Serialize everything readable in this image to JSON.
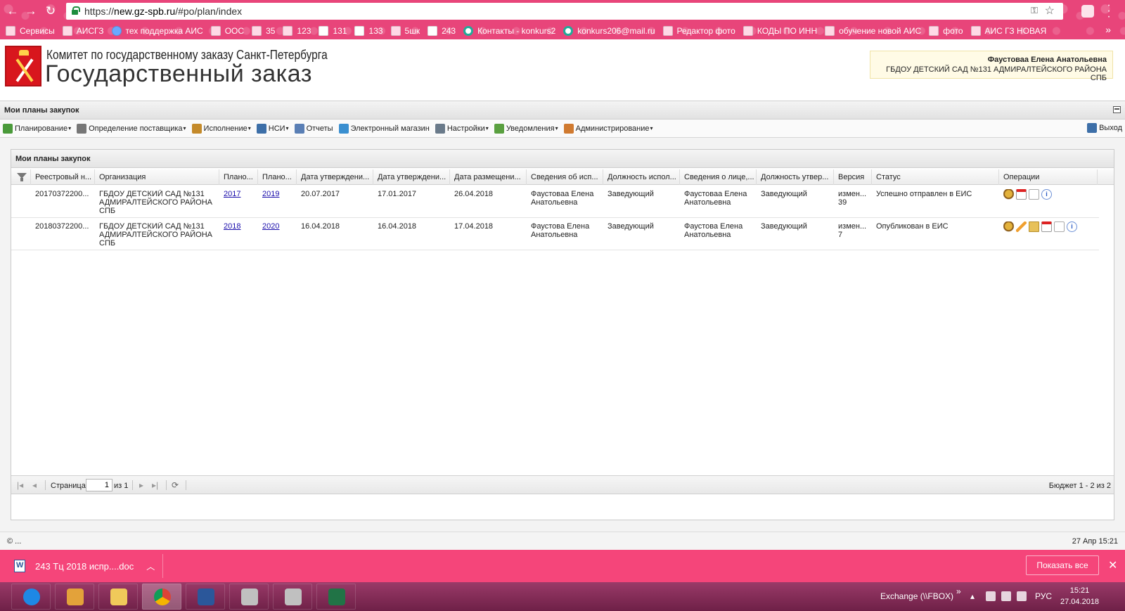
{
  "browser": {
    "url_scheme": "https://",
    "url_host": "new.gz-spb.ru",
    "url_path": "/#po/plan/index",
    "bookmarks": [
      {
        "label": "Сервисы",
        "icon": "apps-icon"
      },
      {
        "label": "АИСГЗ",
        "icon": "bookmark-icon"
      },
      {
        "label": "тех поддержка АИС",
        "icon": "globe-icon"
      },
      {
        "label": "ООС",
        "icon": "emblem-icon"
      },
      {
        "label": "35",
        "icon": "bookmark-icon"
      },
      {
        "label": "123",
        "icon": "bookmark-icon"
      },
      {
        "label": "131",
        "icon": "page-icon"
      },
      {
        "label": "133",
        "icon": "page-icon"
      },
      {
        "label": "5шк",
        "icon": "bookmark-icon"
      },
      {
        "label": "243",
        "icon": "page-icon"
      },
      {
        "label": "Контакты - konkurs2",
        "icon": "mail-icon"
      },
      {
        "label": "konkurs206@mail.ru",
        "icon": "mail-icon"
      },
      {
        "label": "Редактор фото",
        "icon": "photo-icon"
      },
      {
        "label": "КОДЫ ПО ИНН",
        "icon": "bookmark-icon"
      },
      {
        "label": "обучение новой АИС",
        "icon": "bookmark-icon"
      },
      {
        "label": "фото",
        "icon": "bookmark-icon"
      },
      {
        "label": "АИС ГЗ НОВАЯ",
        "icon": "bookmark-icon"
      }
    ],
    "more": "»"
  },
  "header": {
    "subtitle": "Комитет по государственному заказу Санкт-Петербурга",
    "title": "Государственный заказ",
    "user_name": "Фаустоваа Елена Анатольевна",
    "user_org": "ГБДОУ ДЕТСКИЙ САД №131 АДМИРАЛТЕЙСКОГО РАЙОНА СПБ"
  },
  "panel": {
    "title": "Мои планы закупок"
  },
  "toolbar": {
    "items": [
      {
        "label": "Планирование",
        "dropdown": true,
        "icon": "planning-icon",
        "color": "#4a9a3a"
      },
      {
        "label": "Определение поставщика",
        "dropdown": true,
        "icon": "gears-icon",
        "color": "#777777"
      },
      {
        "label": "Исполнение",
        "dropdown": true,
        "icon": "execution-icon",
        "color": "#c48a2a"
      },
      {
        "label": "НСИ",
        "dropdown": true,
        "icon": "book-icon",
        "color": "#3d6fa8"
      },
      {
        "label": "Отчеты",
        "dropdown": false,
        "icon": "report-icon",
        "color": "#5a7fb5"
      },
      {
        "label": "Электронный магазин",
        "dropdown": false,
        "icon": "cart-icon",
        "color": "#3a8fd0"
      },
      {
        "label": "Настройки",
        "dropdown": true,
        "icon": "wrench-icon",
        "color": "#6a7a8a"
      },
      {
        "label": "Уведомления",
        "dropdown": true,
        "icon": "notification-icon",
        "color": "#5aa040"
      },
      {
        "label": "Администрирование",
        "dropdown": true,
        "icon": "admin-user-icon",
        "color": "#d07a30"
      }
    ],
    "exit_label": "Выход"
  },
  "grid": {
    "title": "Мои планы закупок",
    "columns": [
      "Реестровый н...",
      "Организация",
      "Плано...",
      "Плано...",
      "Дата утверждени...",
      "Дата утверждени...",
      "Дата размещени...",
      "Сведения об исп...",
      "Должность испол...",
      "Сведения о лице,...",
      "Должность утвер...",
      "Версия",
      "Статус",
      "Операции"
    ],
    "rows": [
      {
        "reg_no": "20170372200...",
        "org": "ГБДОУ ДЕТСКИЙ САД №131 АДМИРАЛТЕЙСКОГО РАЙОНА СПБ",
        "plan_from": "2017",
        "plan_to": "2019",
        "date_approve1": "20.07.2017",
        "date_approve2": "17.01.2017",
        "date_publish": "26.04.2018",
        "executor": "Фаустоваа Елена Анатольевна",
        "executor_pos": "Заведующий",
        "approver": "Фаустоваа Елена Анатольевна",
        "approver_pos": "Заведующий",
        "version": "измен... 39",
        "status": "Успешно отправлен в ЕИС",
        "ops": [
          "emblem-icon",
          "calendar-icon",
          "document-icon",
          "info-icon"
        ]
      },
      {
        "reg_no": "20180372200...",
        "org": "ГБДОУ ДЕТСКИЙ САД №131 АДМИРАЛТЕЙСКОГО РАЙОНА СПБ",
        "plan_from": "2018",
        "plan_to": "2020",
        "date_approve1": "16.04.2018",
        "date_approve2": "16.04.2018",
        "date_publish": "17.04.2018",
        "executor": "Фаустова Елена Анатольевна",
        "executor_pos": "Заведующий",
        "approver": "Фаустова Елена Анатольевна",
        "approver_pos": "Заведующий",
        "version": "измен... 7",
        "status": "Опубликован в ЕИС",
        "ops": [
          "emblem-icon",
          "edit-pencil-icon",
          "folder-icon",
          "calendar-icon",
          "document-icon",
          "info-icon"
        ]
      }
    ]
  },
  "pager": {
    "page_label": "Страница",
    "page_value": "1",
    "of_label": "из 1",
    "info": "Бюджет 1 - 2 из 2"
  },
  "footer": {
    "copyright": "© ...",
    "datetime": "27 Апр 15:21"
  },
  "download_bar": {
    "file_name": "243 Тц 2018 испр....doc",
    "show_all": "Показать все"
  },
  "taskbar": {
    "tray_label": "Exchange (\\\\FBOX)",
    "tray_more": "»",
    "lang": "РУС",
    "time": "15:21",
    "date": "27.04.2018"
  }
}
